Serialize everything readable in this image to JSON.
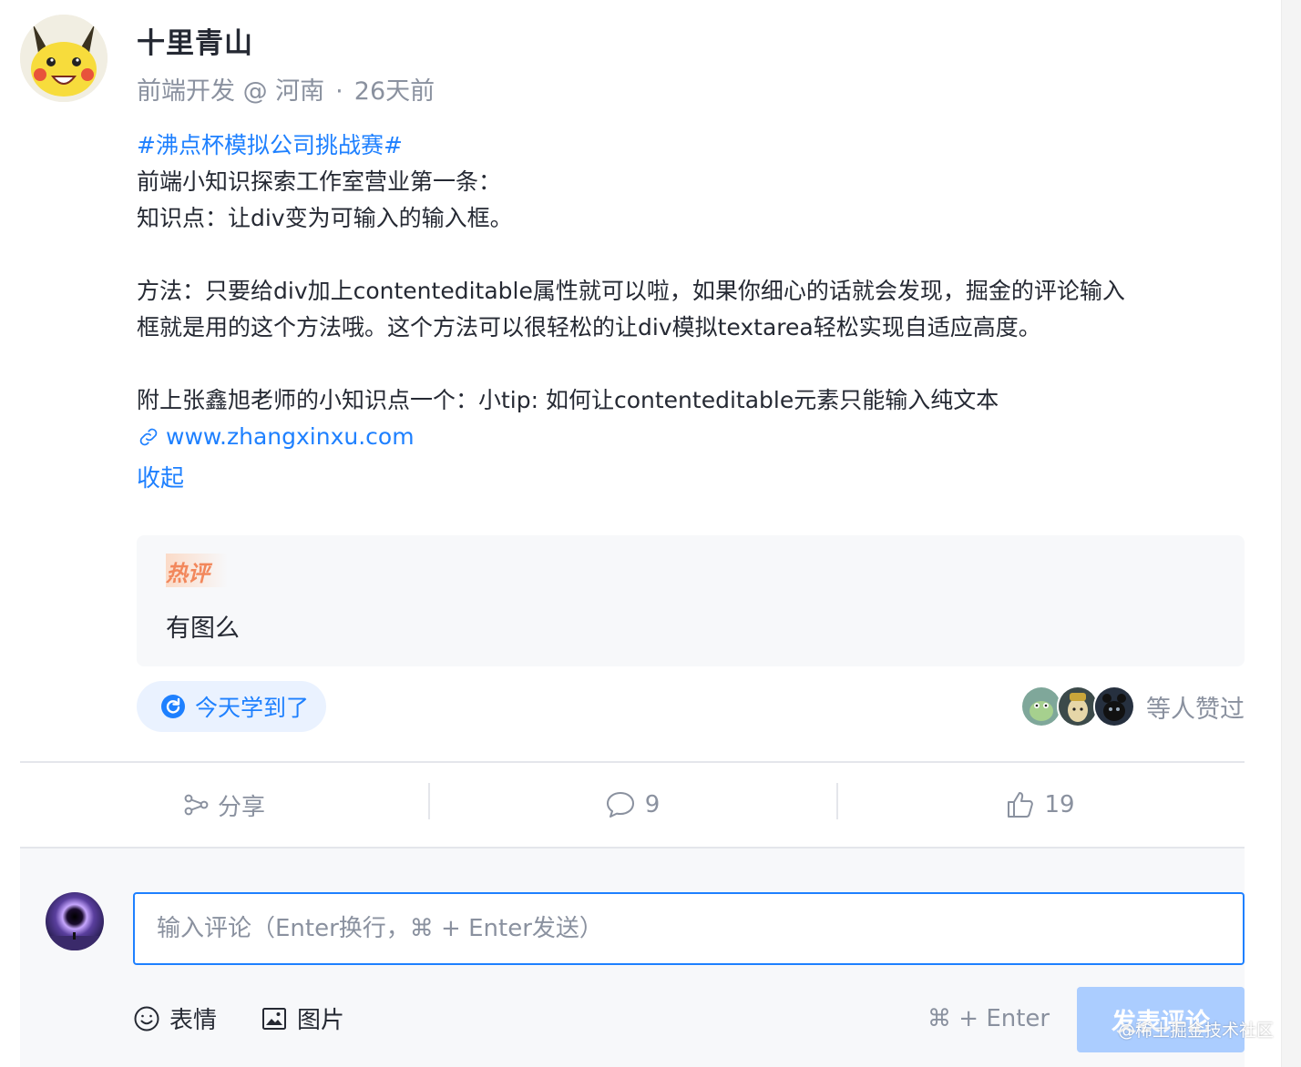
{
  "author": {
    "name": "十里青山",
    "position": "前端开发 @ 河南",
    "separator": "·",
    "time": "26天前"
  },
  "content": {
    "topic": "#沸点杯模拟公司挑战赛#",
    "line1": "前端小知识探索工作室营业第一条：",
    "line2": "知识点：让div变为可输入的输入框。",
    "line3": "方法：只要给div加上contenteditable属性就可以啦，如果你细心的话就会发现，掘金的评论输入",
    "line4": "框就是用的这个方法哦。这个方法可以很轻松的让div模拟textarea轻松实现自适应高度。",
    "line5": "附上张鑫旭老师的小知识点一个：小tip: 如何让contenteditable元素只能输入纯文本",
    "link": "www.zhangxinxu.com",
    "collapse": "收起"
  },
  "hot_comment": {
    "tag": "热评",
    "text": "有图么"
  },
  "learned_label": "今天学到了",
  "likers_text": "等人赞过",
  "actions": {
    "share": "分享",
    "comments": "9",
    "likes": "19"
  },
  "comment_box": {
    "placeholder": "输入评论（Enter换行，⌘ + Enter发送）",
    "emoji": "表情",
    "image": "图片",
    "shortcut": "⌘ + Enter",
    "submit": "发表评论"
  },
  "watermark": "@稀土掘金技术社区",
  "colors": {
    "accent": "#1e80ff",
    "muted": "#8a919f",
    "submit_disabled": "#abcdff",
    "hot": "#f2875b"
  }
}
